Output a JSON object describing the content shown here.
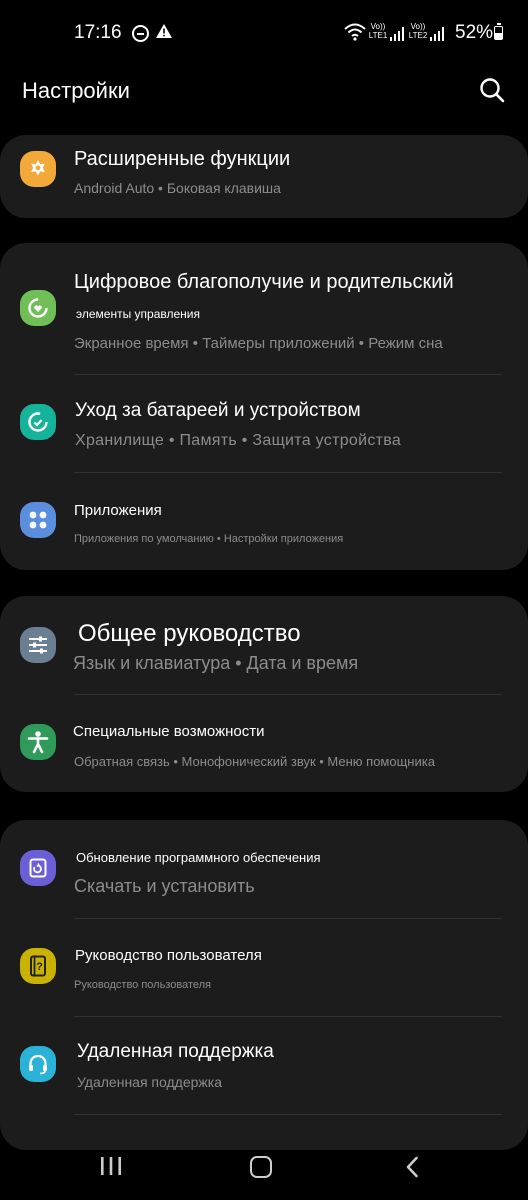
{
  "status": {
    "time": "17:16",
    "sim1": "Vo)) LTE1",
    "sim2": "Vo)) LTE2",
    "battery": "52%",
    "battery_level": 0.52
  },
  "header": {
    "title": "Настройки",
    "search_icon": "search-icon"
  },
  "items": [
    {
      "title": "Расширенные функции",
      "subtitle": "Android Auto • Боковая клавиша",
      "icon": "advanced-features-icon",
      "color": "#f3a93a"
    },
    {
      "title": "Цифровое благополучие и родительский",
      "title2": "элементы управления",
      "subtitle": "Экранное время • Таймеры приложений • Режим сна",
      "icon": "digital-wellbeing-icon",
      "color": "#6fbe56"
    },
    {
      "title": "Уход за батареей и устройством",
      "subtitle": "Хранилище • Память • Защита устройства",
      "icon": "device-care-icon",
      "color": "#16b39b"
    },
    {
      "title": "Приложения",
      "subtitle": "Приложения по умолчанию • Настройки приложения",
      "icon": "apps-icon",
      "color": "#5b8fde"
    },
    {
      "title": "Общее руководство",
      "subtitle": "Язык и клавиатура • Дата и время",
      "icon": "general-management-icon",
      "color": "#6a7f92"
    },
    {
      "title": "Специальные возможности",
      "subtitle": "Обратная связь • Монофонический звук • Меню помощника",
      "icon": "accessibility-icon",
      "color": "#2f9a5a"
    },
    {
      "title": "Обновление программного обеспечения",
      "subtitle": "Скачать и установить",
      "icon": "software-update-icon",
      "color": "#6a5fd6"
    },
    {
      "title": "Руководство пользователя",
      "subtitle": "Руководство пользователя",
      "icon": "user-manual-icon",
      "color": "#c9b200"
    },
    {
      "title": "Удаленная поддержка",
      "subtitle": "Удаленная поддержка",
      "icon": "remote-support-icon",
      "color": "#2ab3d6"
    }
  ]
}
